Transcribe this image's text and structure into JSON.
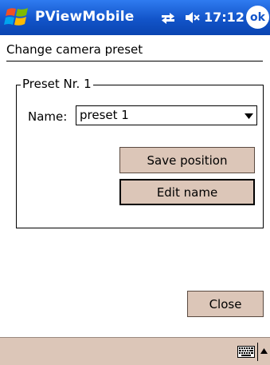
{
  "titlebar": {
    "app_title": "PViewMobile",
    "clock": "17:12",
    "ok_label": "ok",
    "icons": [
      "windows-start-icon",
      "signal-icon",
      "volume-muted-icon"
    ]
  },
  "page": {
    "title": "Change camera preset"
  },
  "preset": {
    "group_label": "Preset Nr. 1",
    "name_label": "Name:",
    "name_value": "preset 1",
    "save_label": "Save position",
    "edit_label": "Edit name"
  },
  "footer": {
    "close_label": "Close"
  },
  "colors": {
    "titlebar": "#1254c9",
    "button_face": "#dcc6b8",
    "bottombar": "#dcc6b8"
  }
}
